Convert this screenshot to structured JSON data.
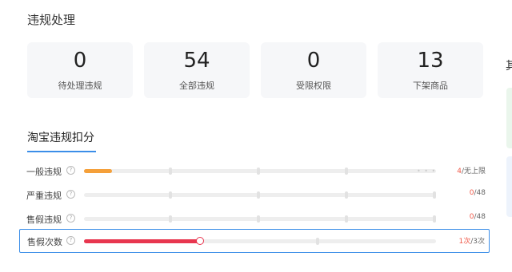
{
  "page_title": "违规处理",
  "cards": [
    {
      "value": "0",
      "label": "待处理违规"
    },
    {
      "value": "54",
      "label": "全部违规"
    },
    {
      "value": "0",
      "label": "受限权限"
    },
    {
      "value": "13",
      "label": "下架商品"
    }
  ],
  "tab": "淘宝违规扣分",
  "right_edge_text": "其",
  "rows": [
    {
      "name": "一般违规",
      "current": "4",
      "max": "无上限",
      "progress": 0.08,
      "color": "#f5a03a"
    },
    {
      "name": "严重违规",
      "current": "0",
      "max": "48",
      "progress": 0,
      "color": "#f5a03a"
    },
    {
      "name": "售假违规",
      "current": "0",
      "max": "48",
      "progress": 0,
      "color": "#f5a03a"
    },
    {
      "name": "售假次数",
      "current": "1次",
      "max": "3次",
      "progress": 0.33,
      "color": "#e8364f"
    }
  ],
  "help_glyph": "?"
}
